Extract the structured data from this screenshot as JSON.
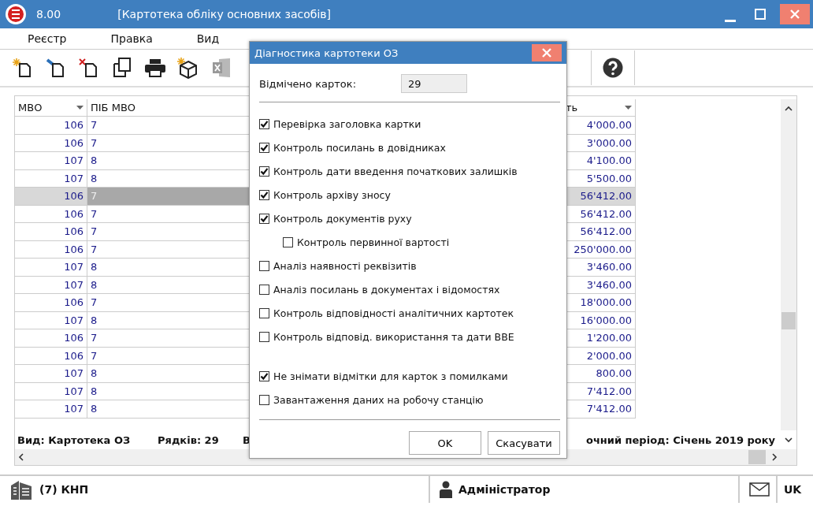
{
  "window": {
    "version": "8.00",
    "title": "[Картотека обліку основних засобів]"
  },
  "menu": [
    "Реєстр",
    "Правка",
    "Вид"
  ],
  "table": {
    "columns": [
      {
        "label": "МВО",
        "dropdown": true
      },
      {
        "label": "ПІБ МВО"
      },
      {
        "label": "ть",
        "dropdown": true
      }
    ],
    "rows": [
      {
        "mvo": "106",
        "name": "7",
        "value": "4'000.00",
        "selected": false
      },
      {
        "mvo": "106",
        "name": "7",
        "value": "3'000.00",
        "selected": false
      },
      {
        "mvo": "107",
        "name": "8",
        "value": "4'100.00",
        "selected": false
      },
      {
        "mvo": "107",
        "name": "8",
        "value": "5'500.00",
        "selected": false
      },
      {
        "mvo": "106",
        "name": "7",
        "value": "56'412.00",
        "selected": true
      },
      {
        "mvo": "106",
        "name": "7",
        "value": "56'412.00",
        "selected": false
      },
      {
        "mvo": "106",
        "name": "7",
        "value": "56'412.00",
        "selected": false
      },
      {
        "mvo": "106",
        "name": "7",
        "value": "250'000.00",
        "selected": false
      },
      {
        "mvo": "107",
        "name": "8",
        "value": "3'460.00",
        "selected": false
      },
      {
        "mvo": "107",
        "name": "8",
        "value": "3'460.00",
        "selected": false
      },
      {
        "mvo": "106",
        "name": "7",
        "value": "18'000.00",
        "selected": false
      },
      {
        "mvo": "107",
        "name": "8",
        "value": "16'000.00",
        "selected": false
      },
      {
        "mvo": "106",
        "name": "7",
        "value": "1'200.00",
        "selected": false
      },
      {
        "mvo": "106",
        "name": "7",
        "value": "2'000.00",
        "selected": false
      },
      {
        "mvo": "107",
        "name": "8",
        "value": "800.00",
        "selected": false
      },
      {
        "mvo": "107",
        "name": "8",
        "value": "7'412.00",
        "selected": false
      },
      {
        "mvo": "107",
        "name": "8",
        "value": "7'412.00",
        "selected": false
      }
    ]
  },
  "status": [
    "Вид: Картотека ОЗ",
    "Рядків: 29",
    "В",
    "очний період: Січень 2019 року"
  ],
  "bottom_bar": {
    "organization": "(7) КНП",
    "user": "Адміністратор",
    "language": "UK"
  },
  "dialog": {
    "title": "Діагностика картотеки ОЗ",
    "marked_label": "Відмічено карток:",
    "marked_value": "29",
    "groups": [
      [
        {
          "label": "Перевірка заголовка картки",
          "checked": true
        },
        {
          "label": "Контроль посилань в довідниках",
          "checked": true
        },
        {
          "label": "Контроль дати введення початкових залишків",
          "checked": true
        },
        {
          "label": "Контроль архіву зносу",
          "checked": true
        },
        {
          "label": "Контроль документів руху",
          "checked": true,
          "children": [
            {
              "label": "Контроль первинної вартості",
              "checked": false
            }
          ]
        },
        {
          "label": "Аналіз наявності реквізитів",
          "checked": false
        },
        {
          "label": "Аналіз посилань в документах і відомостях",
          "checked": false
        },
        {
          "label": "Контроль відповідності аналітичних картотек",
          "checked": false
        },
        {
          "label": "Контроль відповід. використання та дати ВВЕ",
          "checked": false
        }
      ],
      [
        {
          "label": "Не знімати відмітки для карток з помилками",
          "checked": true
        },
        {
          "label": "Завантаження даних на робочу станцію",
          "checked": false
        }
      ]
    ],
    "buttons": [
      "OK",
      "Скасувати"
    ]
  }
}
